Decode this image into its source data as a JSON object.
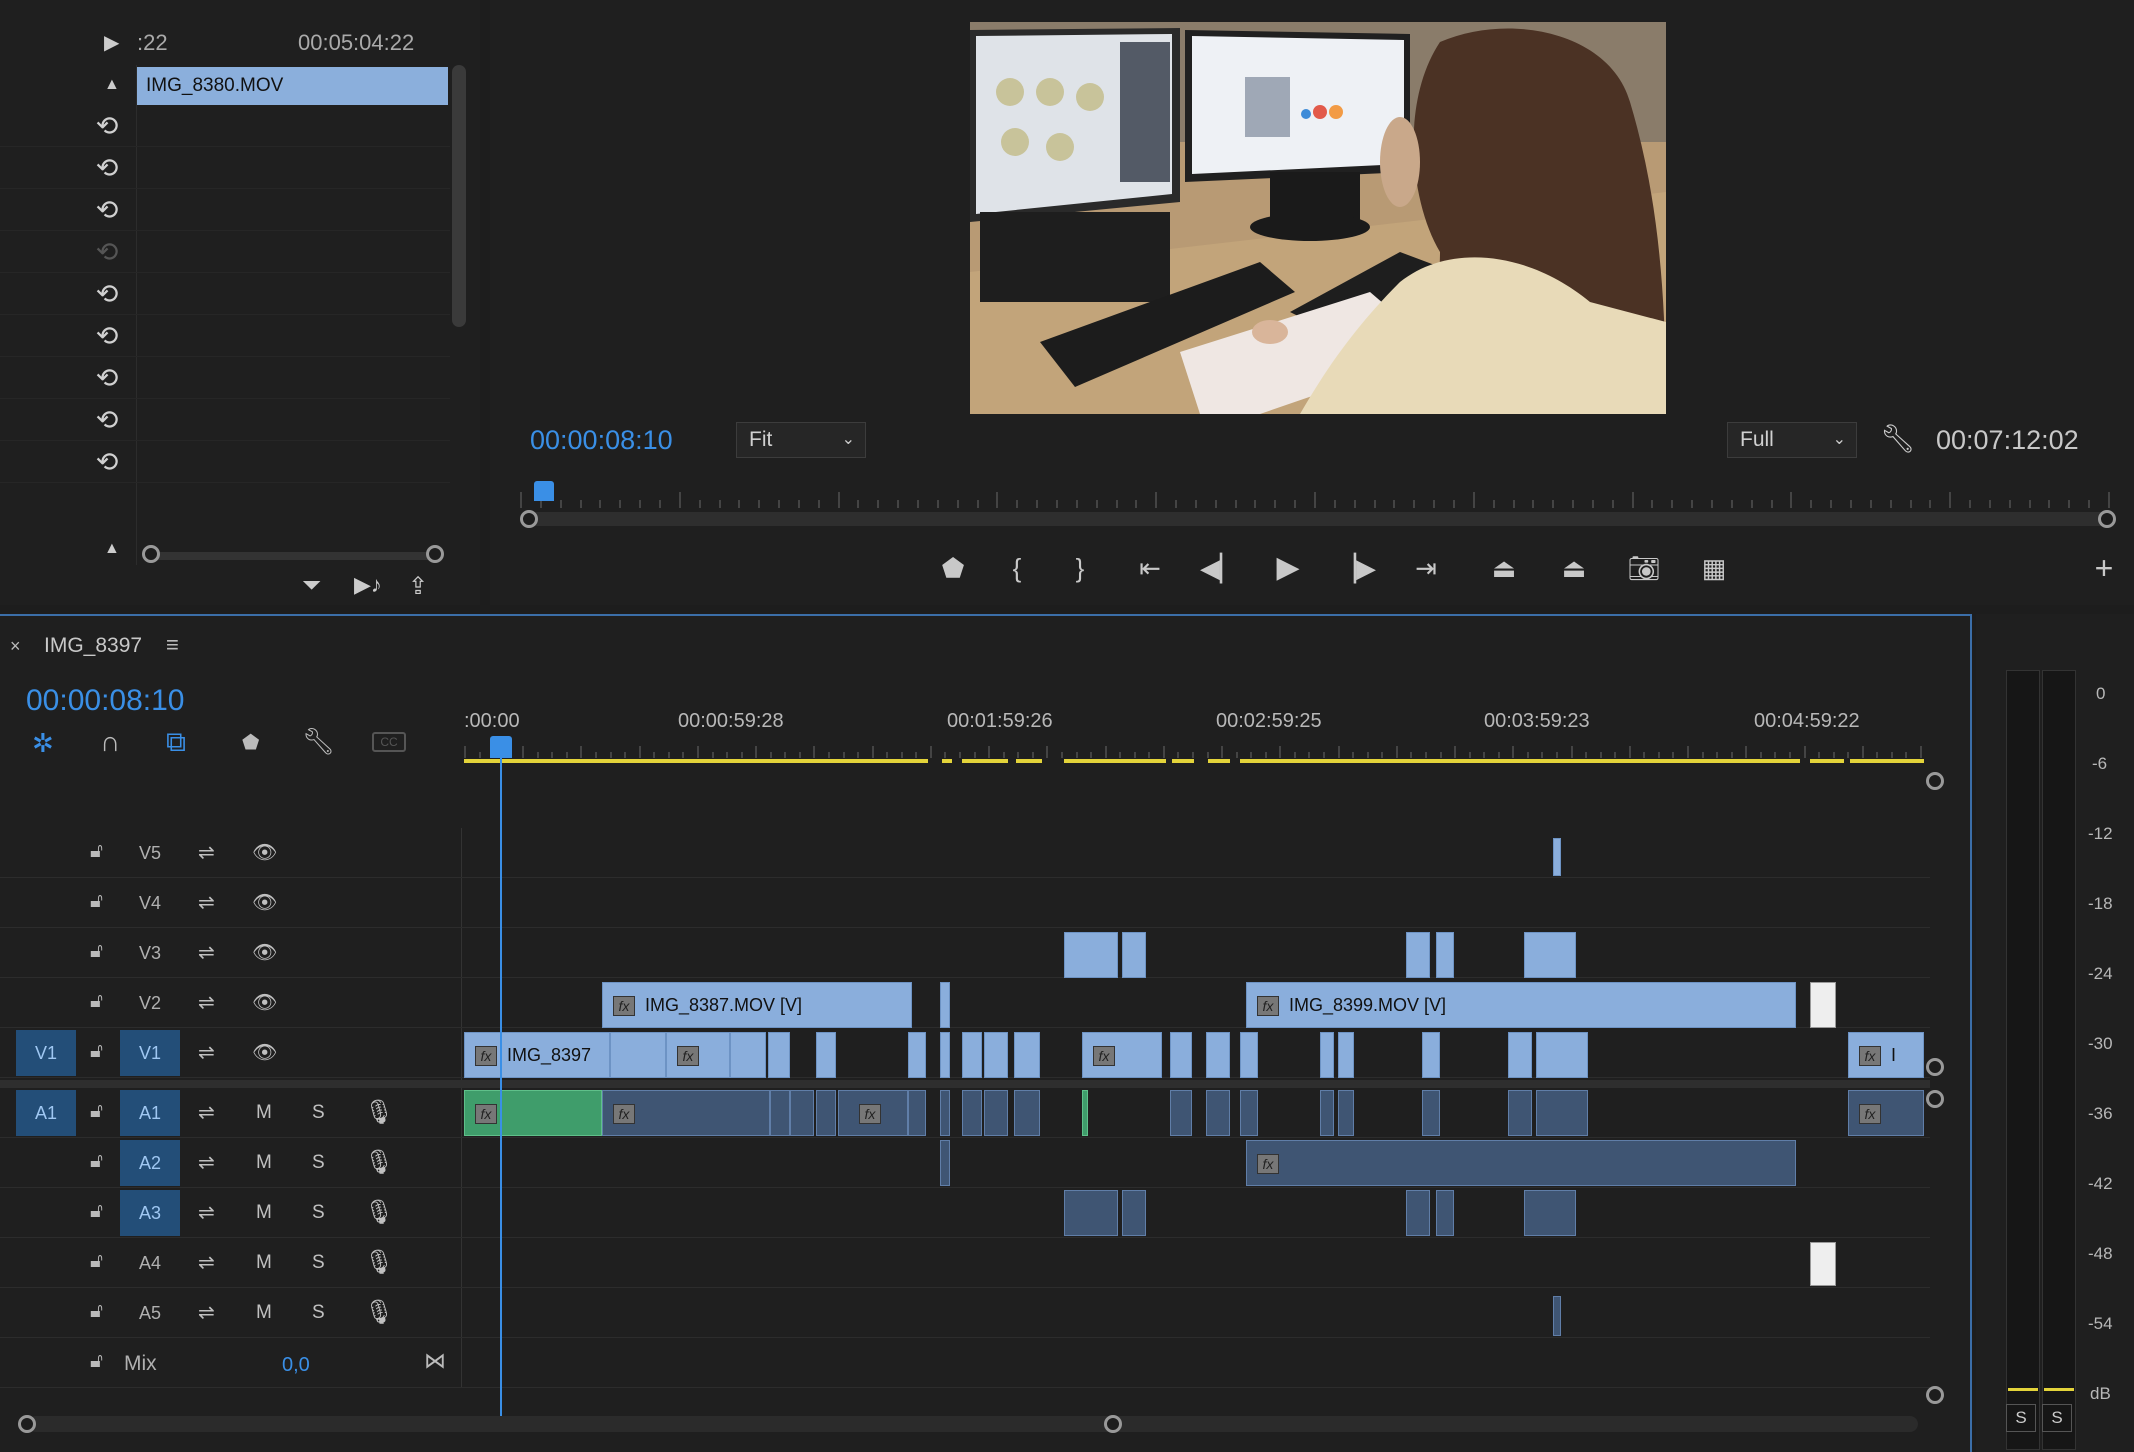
{
  "source_panel": {
    "timecode_left": ":22",
    "timecode_right": "00:05:04:22",
    "clip_name": "IMG_8380.MOV",
    "undo_rows": 9
  },
  "program_monitor": {
    "current_time": "00:00:08:10",
    "zoom_select": "Fit",
    "resolution_select": "Full",
    "duration": "00:07:12:02",
    "playhead_fraction": 0.009
  },
  "timeline": {
    "sequence_name": "IMG_8397",
    "current_time": "00:00:08:10",
    "ruler_labels": [
      ":00:00",
      "00:00:59:28",
      "00:01:59:26",
      "00:02:59:25",
      "00:03:59:23",
      "00:04:59:22"
    ],
    "video_tracks": [
      {
        "name": "V5",
        "source": ""
      },
      {
        "name": "V4",
        "source": ""
      },
      {
        "name": "V3",
        "source": ""
      },
      {
        "name": "V2",
        "source": ""
      },
      {
        "name": "V1",
        "source": "V1"
      }
    ],
    "audio_tracks": [
      {
        "name": "A1",
        "source": "A1"
      },
      {
        "name": "A2",
        "source": ""
      },
      {
        "name": "A3",
        "source": ""
      },
      {
        "name": "A4",
        "source": ""
      },
      {
        "name": "A5",
        "source": ""
      }
    ],
    "track_m": "M",
    "track_s": "S",
    "mix_label": "Mix",
    "mix_value": "0,0",
    "clips": {
      "v2_a": "IMG_8387.MOV [V]",
      "v2_b": "IMG_8399.MOV [V]",
      "v1_a": "IMG_8397",
      "v1_end": "I",
      "fx": "fx"
    }
  },
  "audio_meter": {
    "scale": [
      "0",
      "-6",
      "-12",
      "-18",
      "-24",
      "-30",
      "-36",
      "-42",
      "-48",
      "-54",
      "dB"
    ],
    "solo_left": "S",
    "solo_right": "S"
  },
  "colors": {
    "accent_blue": "#3a8fe6",
    "clip_video": "#8aaedc",
    "clip_audio": "#3f5573",
    "clip_audio_green": "#3f9d6b",
    "render_bar": "#e3d33a"
  }
}
